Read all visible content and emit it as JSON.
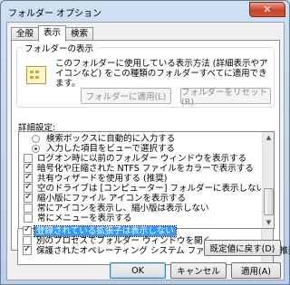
{
  "window": {
    "title": "フォルダー オプション",
    "close_glyph": "✕"
  },
  "tabs": [
    {
      "label": "全般",
      "active": false
    },
    {
      "label": "表示",
      "active": true
    },
    {
      "label": "検索",
      "active": false
    }
  ],
  "folder_views": {
    "group_label": "フォルダーの表示",
    "description": "このフォルダーに使用している表示方法 (詳細表示やアイコンなど) をこの種類のフォルダーすべてに適用できます。",
    "apply_button": "フォルダーに適用(L)",
    "reset_button": "フォルダーをリセット(R)",
    "icon": "folder-view-icon"
  },
  "advanced": {
    "label": "詳細設定:",
    "items": [
      {
        "label": "検索ボックスに自動的に入力する",
        "kind": "radio",
        "checked": false
      },
      {
        "label": "入力した項目をビューで選択する",
        "kind": "radio",
        "checked": true
      },
      {
        "label": "ログオン時に以前のフォルダー ウィンドウを表示する",
        "kind": "check",
        "checked": false
      },
      {
        "label": "暗号化や圧縮された NTFS ファイルをカラーで表示する",
        "kind": "check",
        "checked": true
      },
      {
        "label": "共有ウィザードを使用する (推奨)",
        "kind": "check",
        "checked": true
      },
      {
        "label": "空のドライブは [コンピューター] フォルダーに表示しない",
        "kind": "check",
        "checked": true
      },
      {
        "label": "縮小版にファイル アイコンを表示する",
        "kind": "check",
        "checked": true
      },
      {
        "label": "常にアイコンを表示し、縮小版は表示しない",
        "kind": "check",
        "checked": false
      },
      {
        "label": "常にメニューを表示する",
        "kind": "check",
        "checked": false
      },
      {
        "label": "登録されている拡張子は表示しない",
        "kind": "check",
        "checked": true,
        "selected": true
      },
      {
        "label": "別のプロセスでフォルダー ウィンドウを開く",
        "kind": "check",
        "checked": false
      },
      {
        "label": "保護されたオペレーティング システム ファイルを表示しない (推奨)",
        "kind": "check",
        "checked": true
      }
    ]
  },
  "restore_defaults_button": "既定値に戻す(D)",
  "footer": {
    "ok": "OK",
    "cancel": "キャンセル",
    "apply": "適用(A)"
  }
}
